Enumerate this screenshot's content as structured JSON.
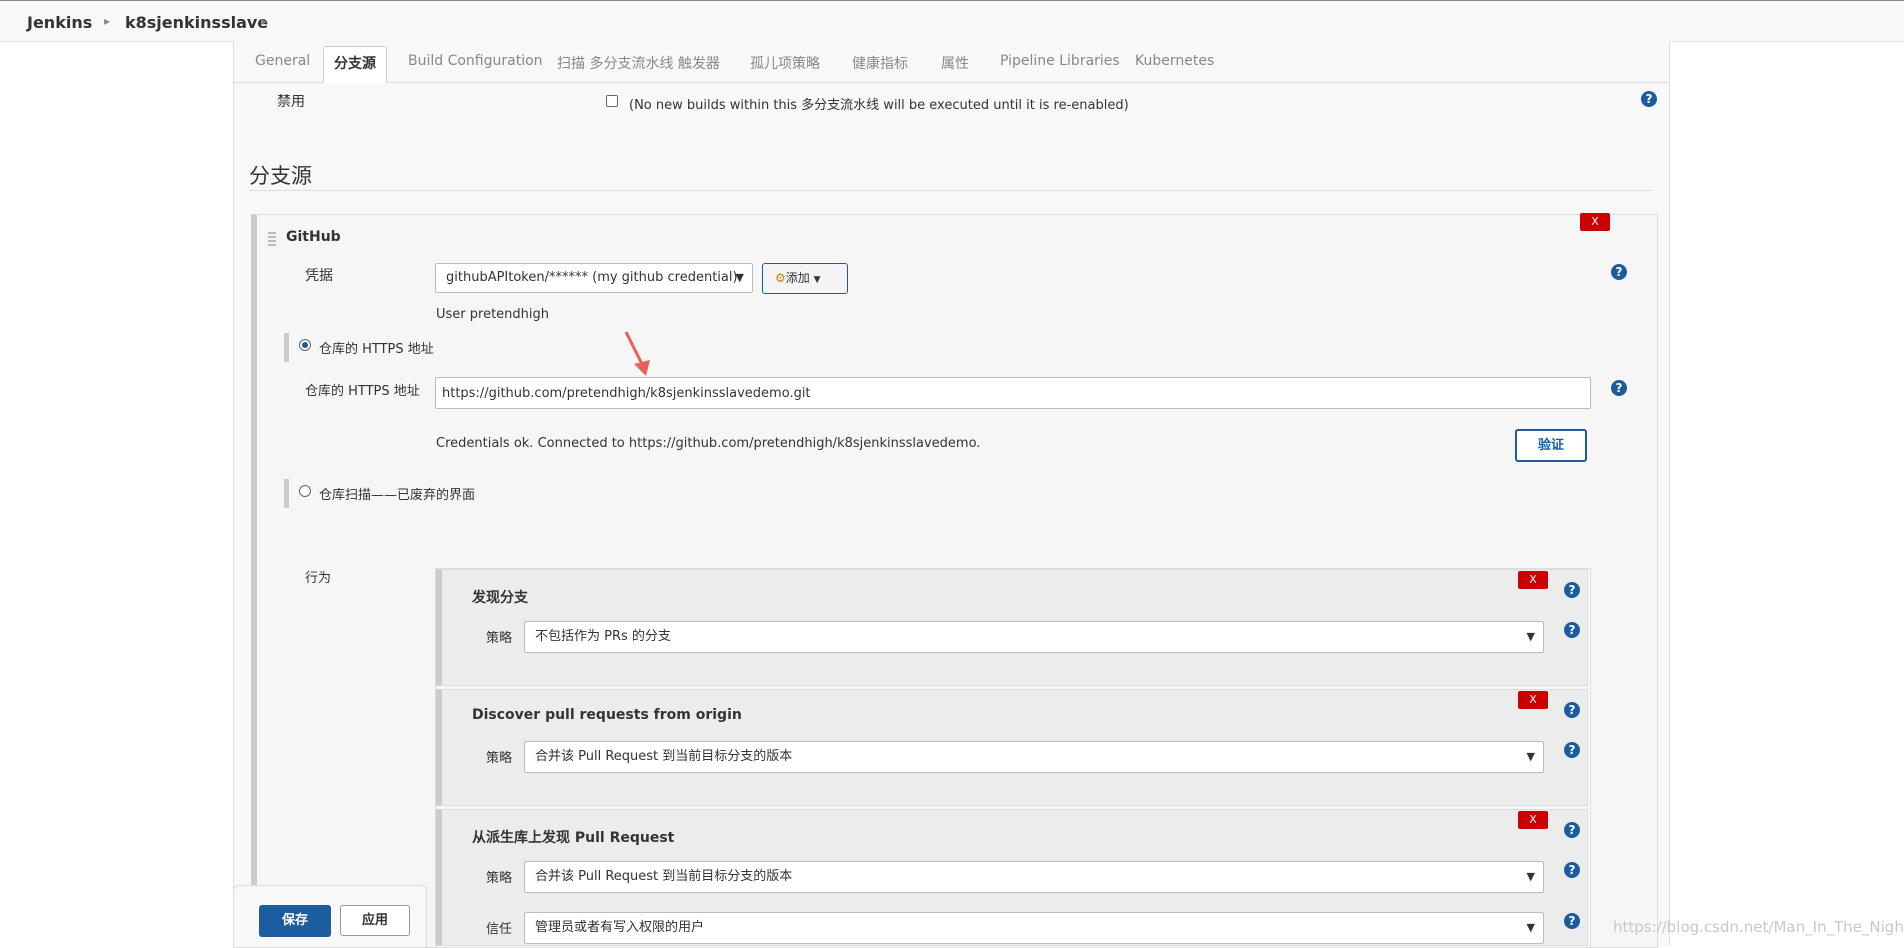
{
  "breadcrumb": {
    "root": "Jenkins",
    "project": "k8sjenkinsslave"
  },
  "tabs": [
    "General",
    "分支源",
    "Build Configuration",
    "扫描 多分支流水线 触发器",
    "孤儿项策略",
    "健康指标",
    "属性",
    "Pipeline Libraries",
    "Kubernetes"
  ],
  "disable": {
    "label": "禁用",
    "checkbox_text": "(No new builds within this 多分支流水线 will be executed until it is re-enabled)"
  },
  "section_title": "分支源",
  "github": {
    "title": "GitHub",
    "delete_label": "X",
    "credentials_label": "凭据",
    "credentials_value": "githubAPItoken/****** (my github credential)",
    "add_button": "添加",
    "user_text": "User pretendhigh",
    "radio_https": "仓库的 HTTPS 地址",
    "repo_url_label": "仓库的 HTTPS 地址",
    "repo_url_value": "https://github.com/pretendhigh/k8sjenkinsslavedemo.git",
    "validation_text": "Credentials ok. Connected to https://github.com/pretendhigh/k8sjenkinsslavedemo.",
    "validate_button": "验证",
    "radio_scan": "仓库扫描——已废弃的界面",
    "behaviors_label": "行为"
  },
  "behaviors": [
    {
      "title": "发现分支",
      "delete_label": "X",
      "strategy_label": "策略",
      "strategy_value": "不包括作为 PRs 的分支"
    },
    {
      "title": "Discover pull requests from origin",
      "delete_label": "X",
      "strategy_label": "策略",
      "strategy_value": "合并该 Pull Request 到当前目标分支的版本"
    },
    {
      "title": "从派生库上发现 Pull Request",
      "delete_label": "X",
      "strategy_label": "策略",
      "strategy_value": "合并该 Pull Request 到当前目标分支的版本",
      "trust_label": "信任",
      "trust_value": "管理员或者有写入权限的用户"
    }
  ],
  "footer": {
    "save": "保存",
    "apply": "应用"
  },
  "help_glyph": "?",
  "watermark": "https://blog.csdn.net/Man_In_The_Night",
  "colors": {
    "accent": "#1a5c9e",
    "delete": "#cc0000",
    "annotation_arrow": "#e8625a"
  }
}
